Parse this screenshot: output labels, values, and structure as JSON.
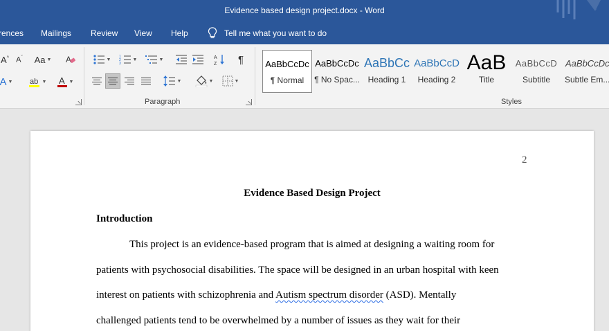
{
  "window": {
    "title": "Evidence based design project.docx  -  Word"
  },
  "tabs": [
    {
      "label": "rences"
    },
    {
      "label": "Mailings"
    },
    {
      "label": "Review"
    },
    {
      "label": "View"
    },
    {
      "label": "Help"
    }
  ],
  "tell_me": {
    "label": "Tell me what you want to do",
    "icon": "lightbulb-icon"
  },
  "ribbon": {
    "font_group": {
      "change_case_label": "Aa",
      "text_highlight_color": "#ffff00",
      "font_color": "#c00000"
    },
    "paragraph_group": {
      "label": "Paragraph",
      "active_alignment": "center"
    },
    "styles_group": {
      "label": "Styles",
      "items": [
        {
          "preview": "AaBbCcDc",
          "name": "¶ Normal"
        },
        {
          "preview": "AaBbCcDc",
          "name": "¶ No Spac..."
        },
        {
          "preview": "AaBbCc",
          "name": "Heading 1"
        },
        {
          "preview": "AaBbCcD",
          "name": "Heading 2"
        },
        {
          "preview": "AaB",
          "name": "Title"
        },
        {
          "preview": "AaBbCcD",
          "name": "Subtitle"
        },
        {
          "preview": "AaBbCcDc",
          "name": "Subtle Em..."
        }
      ]
    }
  },
  "document": {
    "page_number": "2",
    "title": "Evidence Based Design Project",
    "heading": "Introduction",
    "paragraph_lines": [
      {
        "before": "This project is an evidence-based program that is aimed at designing a waiting room for",
        "flagged": "",
        "after": ""
      },
      {
        "before": "patients with psychosocial disabilities. The space will be designed in an urban hospital with keen",
        "flagged": "",
        "after": ""
      },
      {
        "before": "interest on patients with schizophrenia and ",
        "flagged": "Autism spectrum disorder",
        "after": " (ASD). Mentally"
      },
      {
        "before": "challenged patients tend to be overwhelmed by a number of issues as they wait for their",
        "flagged": "",
        "after": ""
      }
    ]
  }
}
